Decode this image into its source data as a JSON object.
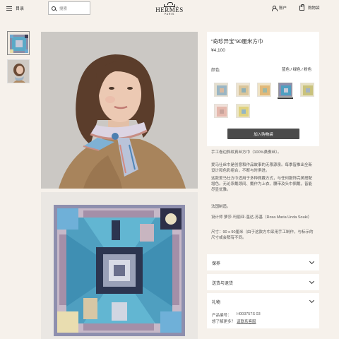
{
  "header": {
    "menu_label": "目录",
    "search_placeholder": "搜索",
    "logo_name": "HERMÈS",
    "logo_city": "PARIS",
    "account_label": "账户",
    "bag_label": "购物袋"
  },
  "product": {
    "title": "“奇珍异宝”90厘米方巾",
    "price": "¥4,100",
    "color_label": "颜色",
    "color_name": "蓝色 / 绿色 / 粉色",
    "swatch_count": 7,
    "selected_swatch_index": 3,
    "add_to_cart": "加入购物袋",
    "description": [
      "手工卷边斜纹真丝方巾（100%桑蚕丝）。",
      "",
      "爱马仕丝巾是创意和作品故事的无限源泉。每季皆推出全新设计和色彩组合，不断与时俱进。",
      "这款爱马仕方巾适用于多种佩戴方式，与任何服饰完美搭配增色。无论系戴颈间、戴作为上衣、腰带及头巾佩戴，皆能尽显优雅。",
      "",
      "法国制造。",
      "",
      "设计师 萝莎·玛丽亚·温达·苏基（Rosa Maria Unda Souki）",
      "",
      "尺寸：90 x 90厘米（由于这款方巾采用手工制作，与标示的尺寸或会稍有不同。"
    ]
  },
  "accordions": [
    {
      "title": "保养"
    },
    {
      "title": "送货与退货"
    },
    {
      "title": "礼物"
    }
  ],
  "details": {
    "product_number_label": "产品编号：",
    "product_number": "H003757S 03",
    "help_label": "想了解更多？",
    "help_link": "请联系客服"
  },
  "colors": {
    "accent_dark": "#4b4b4b",
    "background": "#f6f1eb",
    "panel": "#ffffff"
  }
}
